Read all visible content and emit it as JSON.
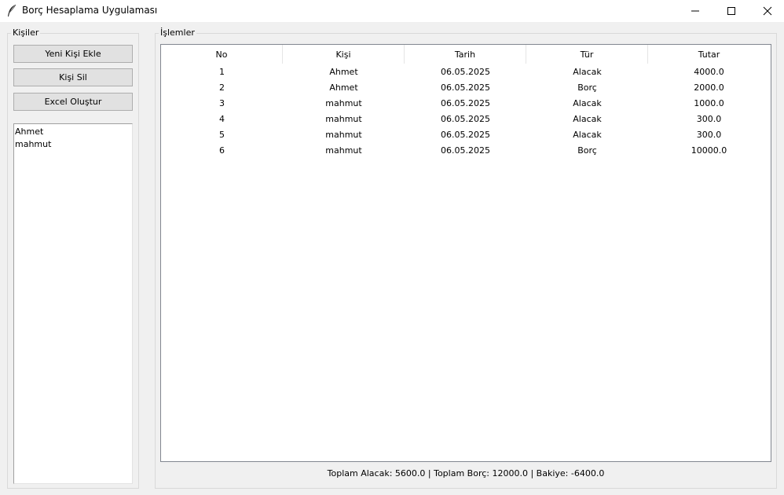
{
  "window": {
    "title": "Borç Hesaplama Uygulaması",
    "icon": "feather-icon"
  },
  "persons": {
    "group_title": "Kişiler",
    "add_button": "Yeni Kişi Ekle",
    "delete_button": "Kişi Sil",
    "excel_button": "Excel Oluştur",
    "list": [
      "Ahmet",
      "mahmut"
    ]
  },
  "operations": {
    "group_title": "İşlemler",
    "columns": [
      "No",
      "Kişi",
      "Tarih",
      "Tür",
      "Tutar"
    ],
    "rows": [
      [
        "1",
        "Ahmet",
        "06.05.2025",
        "Alacak",
        "4000.0"
      ],
      [
        "2",
        "Ahmet",
        "06.05.2025",
        "Borç",
        "2000.0"
      ],
      [
        "3",
        "mahmut",
        "06.05.2025",
        "Alacak",
        "1000.0"
      ],
      [
        "4",
        "mahmut",
        "06.05.2025",
        "Alacak",
        "300.0"
      ],
      [
        "5",
        "mahmut",
        "06.05.2025",
        "Alacak",
        "300.0"
      ],
      [
        "6",
        "mahmut",
        "06.05.2025",
        "Borç",
        "10000.0"
      ]
    ]
  },
  "summary": "Toplam Alacak: 5600.0 | Toplam Borç: 12000.0 | Bakiye: -6400.0"
}
